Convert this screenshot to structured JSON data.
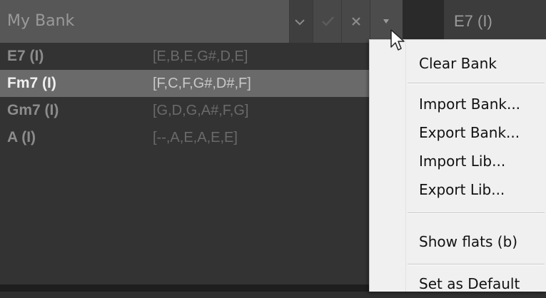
{
  "bank": {
    "name": "My Bank",
    "current_chord": "E7 (I)"
  },
  "toolbar": {
    "dropdown_icon": "chevron-down-icon",
    "confirm_icon": "check-icon",
    "cancel_icon": "close-icon",
    "menu_icon": "triangle-down-icon"
  },
  "chords": [
    {
      "name": "E7 (I)",
      "notes": "[E,B,E,G#,D,E]",
      "selected": false
    },
    {
      "name": "Fm7 (I)",
      "notes": "[F,C,F,G#,D#,F]",
      "selected": true
    },
    {
      "name": "Gm7 (I)",
      "notes": "[G,D,G,A#,F,G]",
      "selected": false
    },
    {
      "name": "A  (I)",
      "notes": "[--,A,E,A,E,E]",
      "selected": false
    }
  ],
  "menu": {
    "items": [
      {
        "label": "Clear Bank"
      },
      {
        "label": "Import Bank..."
      },
      {
        "label": "Export Bank..."
      },
      {
        "label": "Import Lib..."
      },
      {
        "label": "Export Lib..."
      },
      {
        "label": "Show flats (b)"
      },
      {
        "label": "Set as Default"
      }
    ]
  },
  "colors": {
    "background": "#2f2f2f",
    "selected_row": "#6a6a6a",
    "menu_background": "#f0f0f0"
  }
}
